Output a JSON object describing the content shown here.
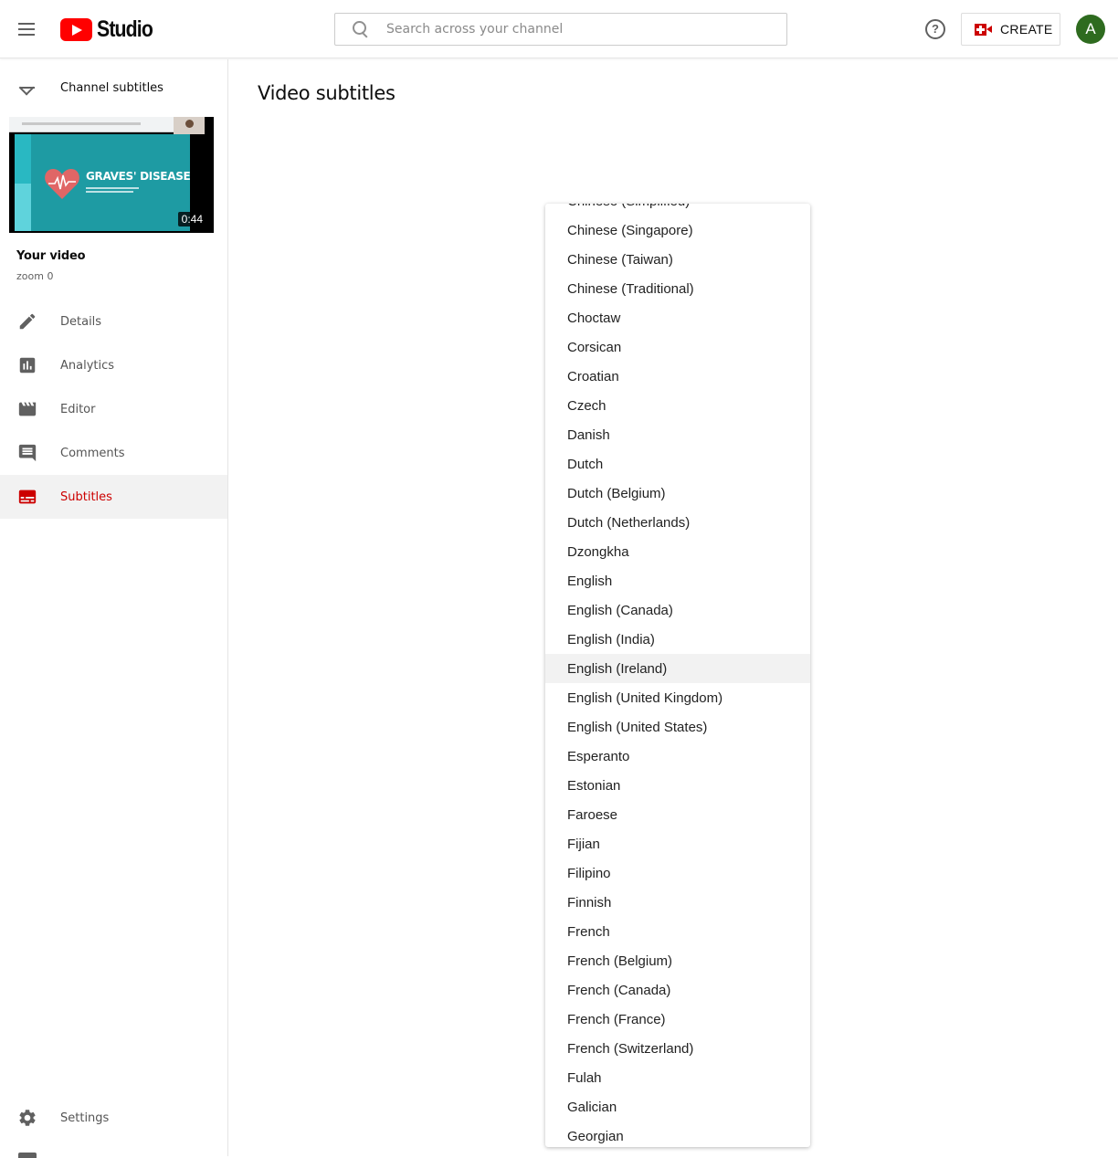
{
  "header": {
    "logo_text": "Studio",
    "search_placeholder": "Search across your channel",
    "help_label": "?",
    "create_label": "CREATE",
    "avatar_initial": "A",
    "colors": {
      "brand_red": "#ff0000",
      "create_red": "#cc0000",
      "avatar_bg": "#2e6b1f"
    }
  },
  "sidebar": {
    "back_label": "Channel subtitles",
    "thumbnail": {
      "title_text": "GRAVES' DISEASE",
      "duration": "0:44"
    },
    "your_video_label": "Your video",
    "video_name": "zoom 0",
    "items": [
      {
        "label": "Details",
        "icon": "pencil-icon",
        "active": false
      },
      {
        "label": "Analytics",
        "icon": "analytics-icon",
        "active": false
      },
      {
        "label": "Editor",
        "icon": "clapperboard-icon",
        "active": false
      },
      {
        "label": "Comments",
        "icon": "comment-icon",
        "active": false
      },
      {
        "label": "Subtitles",
        "icon": "subtitles-icon",
        "active": true
      }
    ],
    "settings_label": "Settings",
    "active_color": "#cc0000"
  },
  "main": {
    "title": "Video subtitles"
  },
  "language_dropdown": {
    "hovered": "English (Ireland)",
    "options": [
      "Chinese (Simplified)",
      "Chinese (Singapore)",
      "Chinese (Taiwan)",
      "Chinese (Traditional)",
      "Choctaw",
      "Corsican",
      "Croatian",
      "Czech",
      "Danish",
      "Dutch",
      "Dutch (Belgium)",
      "Dutch (Netherlands)",
      "Dzongkha",
      "English",
      "English (Canada)",
      "English (India)",
      "English (Ireland)",
      "English (United Kingdom)",
      "English (United States)",
      "Esperanto",
      "Estonian",
      "Faroese",
      "Fijian",
      "Filipino",
      "Finnish",
      "French",
      "French (Belgium)",
      "French (Canada)",
      "French (France)",
      "French (Switzerland)",
      "Fulah",
      "Galician",
      "Georgian"
    ]
  }
}
